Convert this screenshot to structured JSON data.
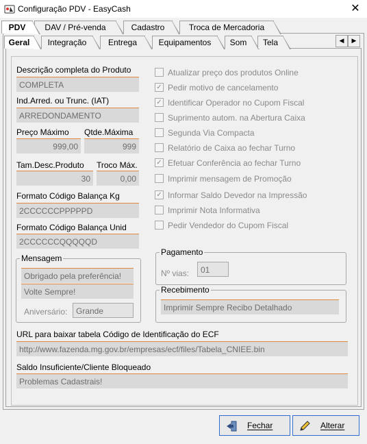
{
  "window": {
    "title": "Configuração PDV - EasyCash",
    "close_label": "✕"
  },
  "top_tabs": [
    {
      "label": "PDV",
      "active": true
    },
    {
      "label": "DAV / Pré-venda",
      "active": false
    },
    {
      "label": "Cadastro",
      "active": false
    },
    {
      "label": "Troca de Mercadoria",
      "active": false
    }
  ],
  "sub_tabs": [
    {
      "label": "Geral",
      "active": true
    },
    {
      "label": "Integração",
      "active": false
    },
    {
      "label": "Entrega",
      "active": false
    },
    {
      "label": "Equipamentos",
      "active": false
    },
    {
      "label": "Som",
      "active": false
    },
    {
      "label": "Tela",
      "active": false
    }
  ],
  "tab_scroll": {
    "left": "◀",
    "right": "▶"
  },
  "fields": {
    "descricao_label": "Descrição completa do Produto",
    "descricao_value": "COMPLETA",
    "arred_label": "Ind.Arred. ou Trunc. (IAT)",
    "arred_value": "ARREDONDAMENTO",
    "preco_max_label": "Preço Máximo",
    "preco_max_value": "999,00",
    "qtde_max_label": "Qtde.Máxima",
    "qtde_max_value": "999",
    "tam_desc_label": "Tam.Desc.Produto",
    "tam_desc_value": "30",
    "troco_max_label": "Troco Máx.",
    "troco_max_value": "0,00",
    "balanca_kg_label": "Formato Código Balança Kg",
    "balanca_kg_value": "2CCCCCCPPPPPD",
    "balanca_unid_label": "Formato Código Balança Unid",
    "balanca_unid_value": "2CCCCCCQQQQQD"
  },
  "mensagem": {
    "title": "Mensagem",
    "line1": "Obrigado pela preferência!",
    "line2": "Volte Sempre!",
    "aniversario_label": "Aniversário:",
    "aniversario_value": "Grande"
  },
  "checkboxes": [
    {
      "label": "Atualizar preço dos produtos Online",
      "checked": false
    },
    {
      "label": "Pedir motivo de cancelamento",
      "checked": true
    },
    {
      "label": "Identificar Operador no Cupom Fiscal",
      "checked": true
    },
    {
      "label": "Suprimento autom. na Abertura Caixa",
      "checked": false
    },
    {
      "label": "Segunda Via Compacta",
      "checked": false
    },
    {
      "label": "Relatório de Caixa ao fechar Turno",
      "checked": false
    },
    {
      "label": "Efetuar Conferência ao fechar Turno",
      "checked": true
    },
    {
      "label": "Imprimir mensagem de Promoção",
      "checked": false
    },
    {
      "label": "Informar Saldo Devedor na Impressão",
      "checked": true
    },
    {
      "label": "Imprimir Nota Informativa",
      "checked": false
    },
    {
      "label": "Pedir Vendedor do Cupom Fiscal",
      "checked": false
    }
  ],
  "pagamento": {
    "title": "Pagamento",
    "vias_label": "Nº vias:",
    "vias_value": "01"
  },
  "recebimento": {
    "title": "Recebimento",
    "value": "Imprimir Sempre Recibo Detalhado"
  },
  "url": {
    "label": "URL para baixar tabela Código de Identificação do ECF",
    "value": "http://www.fazenda.mg.gov.br/empresas/ecf/files/Tabela_CNIEE.bin"
  },
  "saldo": {
    "label": "Saldo Insuficiente/Cliente Bloqueado",
    "value": "Problemas Cadastrais!"
  },
  "buttons": {
    "fechar": "Fechar",
    "alterar": "Alterar"
  },
  "colors": {
    "accent_line": "#e08a3c",
    "field_bg": "#d9d9d9",
    "button_border": "#2f6bd1"
  },
  "icons": {
    "app": "app-icon",
    "close": "close-icon",
    "fechar": "exit-door-icon",
    "alterar": "pencil-edit-icon"
  }
}
